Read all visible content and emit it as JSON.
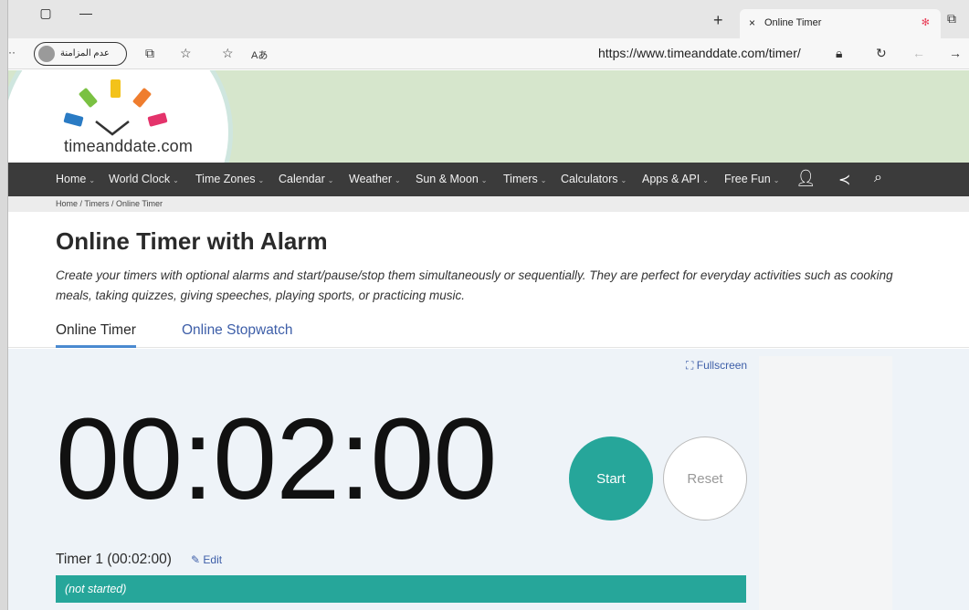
{
  "browser": {
    "tab_title": "Online Timer",
    "tab_close": "×",
    "new_tab": "+",
    "profile_label": "عدم المزامنة",
    "url": "https://www.timeanddate.com/timer/"
  },
  "site": {
    "logo_main": "timeanddate",
    "logo_suffix": ".com",
    "nav": [
      "Home",
      "World Clock",
      "Time Zones",
      "Calendar",
      "Weather",
      "Sun & Moon",
      "Timers",
      "Calculators",
      "Apps & API",
      "Free Fun"
    ],
    "breadcrumb": "Home /  Timers /  Online Timer"
  },
  "main": {
    "title": "Online Timer with Alarm",
    "description": "Create your timers with optional alarms and start/pause/stop them simultaneously or sequentially. They are perfect for everyday activities such as cooking meals, taking quizzes, giving speeches, playing sports, or practicing music.",
    "tabs": [
      "Online Timer",
      "Online Stopwatch"
    ]
  },
  "timer": {
    "fullscreen_label": "Fullscreen",
    "display": "00:02:00",
    "start_label": "Start",
    "reset_label": "Reset",
    "timer_name": "Timer 1 (00:02:00)",
    "edit_label": "Edit",
    "status": "(not started)"
  },
  "colors": {
    "accent": "#26a69a",
    "nav_bg": "#3b3b3b",
    "link": "#3d5ea8"
  }
}
